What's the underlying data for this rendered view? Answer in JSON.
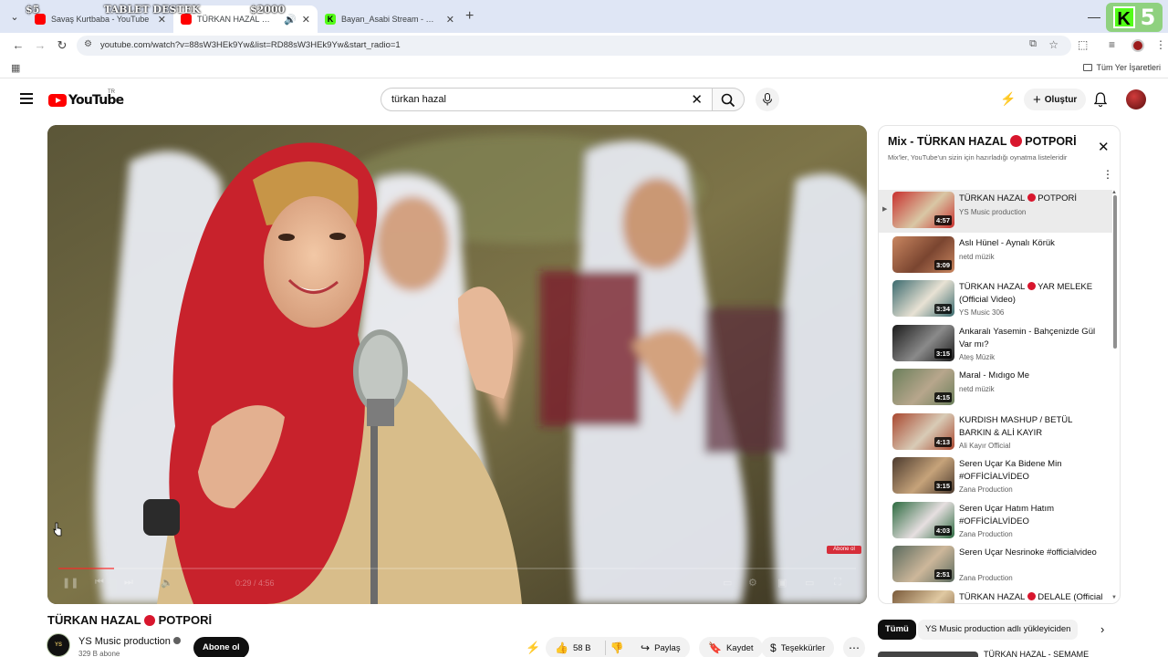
{
  "browser": {
    "tabs": [
      {
        "title": "Savaş Kurtbaba - YouTube",
        "active": false
      },
      {
        "title": "TÜRKAN HAZAL 🔴 POTPO",
        "active": true
      },
      {
        "title": "Bayan_Asabi Stream - Watch L",
        "active": false
      }
    ],
    "url": "youtube.com/watch?v=88sW3HEk9Yw&list=RD88sW3HEk9Yw&start_radio=1",
    "bookmarks_right": "Tüm Yer İşaretleri",
    "overlay": {
      "left": "$5",
      "center": "TABLET DESTEK",
      "right": "$2000",
      "badge_letter": "K",
      "badge_number": "5"
    }
  },
  "header": {
    "logo": "YouTube",
    "country": "TR",
    "search_query": "türkan hazal",
    "create_label": "Oluştur"
  },
  "player": {
    "time": "0:29 / 4:56",
    "progress": 0.07,
    "watermark": "Abone ol"
  },
  "video": {
    "title": "TÜRKAN HAZAL",
    "title_suffix": "POTPORİ",
    "channel": "YS Music production",
    "channel_avatar_text": "YS",
    "subs": "329 B abone",
    "subscribe": "Abone ol",
    "likes": "58 B",
    "share": "Paylaş",
    "save": "Kaydet",
    "thanks": "Teşekkürler"
  },
  "mix": {
    "title": "Mix - TÜRKAN HAZAL",
    "title_suffix": "POTPORİ",
    "subtitle": "Mix'ler, YouTube'un sizin için hazırladığı oynatma listeleridir",
    "items": [
      {
        "title": "TÜRKAN HAZAL",
        "title_suffix": "POTPORİ",
        "channel": "YS Music production",
        "duration": "4:57",
        "colors": [
          "#c8302e",
          "#d9c7a5"
        ],
        "active": true
      },
      {
        "title": "Aslı Hünel - Aynalı Körük",
        "title_suffix": "",
        "channel": "netd müzik",
        "duration": "3:09",
        "colors": [
          "#c98660",
          "#7a4530"
        ],
        "active": false
      },
      {
        "title": "TÜRKAN HAZAL",
        "title_suffix": "YAR MELEKE (Official Video)",
        "channel": "YS Music 306",
        "duration": "3:34",
        "colors": [
          "#3a6a6e",
          "#e8e2d4"
        ],
        "active": false
      },
      {
        "title": "Ankaralı Yasemin - Bahçenizde Gül Var mı?",
        "title_suffix": "",
        "channel": "Ateş Müzik",
        "duration": "3:15",
        "colors": [
          "#1b1b1b",
          "#8a8a8a"
        ],
        "active": false
      },
      {
        "title": "Maral - Mıdıgo Me",
        "title_suffix": "",
        "channel": "netd müzik",
        "duration": "4:15",
        "colors": [
          "#6b7f5b",
          "#b7a68c"
        ],
        "active": false
      },
      {
        "title": "KURDISH MASHUP / BETÜL BARKIN & ALİ KAYIR",
        "title_suffix": "",
        "channel": "Ali Kayır Official",
        "duration": "4:13",
        "colors": [
          "#a9472f",
          "#d8cbb6"
        ],
        "active": false
      },
      {
        "title": "Seren Uçar Ka Bidene Min #OFFİCİALVİDEO",
        "title_suffix": "",
        "channel": "Zana Production",
        "duration": "3:15",
        "colors": [
          "#4b3a2e",
          "#c6a37a"
        ],
        "active": false
      },
      {
        "title": "Seren Uçar Hatım Hatım #OFFİCİALVİDEO",
        "title_suffix": "",
        "channel": "Zana Production",
        "duration": "4:03",
        "colors": [
          "#2c6a3f",
          "#e6dfe0"
        ],
        "active": false
      },
      {
        "title": "Seren Uçar Nesrinoke #officialvideo",
        "title_suffix": "",
        "channel": "Zana Production",
        "duration": "2:51",
        "colors": [
          "#5a6a5e",
          "#cdb79a"
        ],
        "active": false
      },
      {
        "title": "TÜRKAN HAZAL",
        "title_suffix": "DELALE (Official Video)",
        "channel": "",
        "duration": "",
        "colors": [
          "#7a5a3a",
          "#e0c9a2"
        ],
        "active": false
      }
    ]
  },
  "chips": [
    "Tümü",
    "YS Music production adlı yükleyiciden"
  ],
  "next_rec_title": "TÜRKAN HAZAL - SEMAME"
}
